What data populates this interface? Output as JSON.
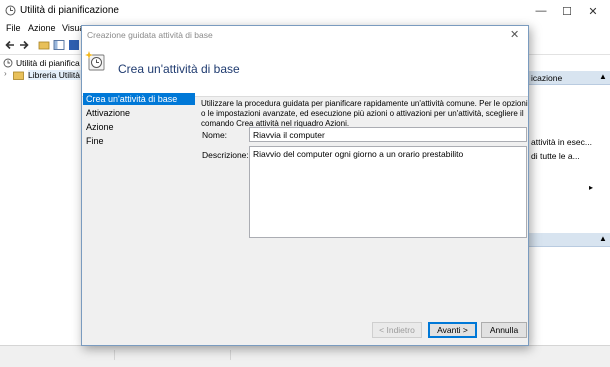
{
  "main": {
    "title": "Utilità di pianificazione",
    "minimize": "—",
    "maximize": "☐",
    "close": "✕",
    "menu": [
      "File",
      "Azione",
      "Visua"
    ],
    "tree": {
      "root": "Utilità di pianifica",
      "library": "Libreria Utilità d"
    },
    "actions": {
      "header1": "icazione",
      "item1": "attività in esec...",
      "item2": "di tutte le a...",
      "arrow": "▸"
    },
    "status_items": [
      "",
      ""
    ]
  },
  "dialog": {
    "title": "Creazione guidata attività di base",
    "heading": "Crea un'attività di base",
    "close": "✕",
    "steps": [
      "Crea un'attività di base",
      "Attivazione",
      "Azione",
      "Fine"
    ],
    "intro": "Utilizzare la procedura guidata per pianificare rapidamente un'attività comune. Per le opzioni o le impostazioni avanzate, ed esecuzione più azioni o attivazioni per un'attività, scegliere il comando Crea attività nel riquadro Azioni.",
    "name_label": "Nome:",
    "name_value": "Riavvia il computer",
    "desc_label": "Descrizione:",
    "desc_value": "Riavvio del computer ogni giorno a un orario prestabilito",
    "back": "< Indietro",
    "next": "Avanti >",
    "cancel": "Annulla"
  }
}
